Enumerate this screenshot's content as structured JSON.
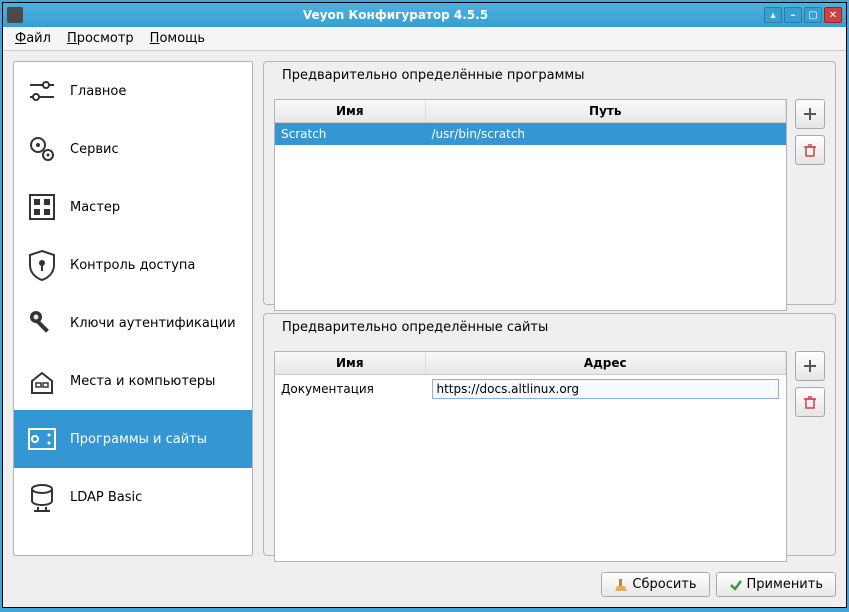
{
  "window": {
    "title": "Veyon Конфигуратор 4.5.5"
  },
  "menu": {
    "file": "Файл",
    "view": "Просмотр",
    "help": "Помощь"
  },
  "nav": {
    "main": "Главное",
    "service": "Сервис",
    "master": "Мастер",
    "access": "Контроль доступа",
    "keys": "Ключи аутентификации",
    "places": "Места и компьютеры",
    "programs": "Программы и сайты",
    "ldap": "LDAP Basic"
  },
  "groups": {
    "programs": {
      "title": "Предварительно определённые программы",
      "col_name": "Имя",
      "col_path": "Путь",
      "rows": [
        {
          "name": "Scratch",
          "path": "/usr/bin/scratch"
        }
      ]
    },
    "sites": {
      "title": "Предварительно определённые сайты",
      "col_name": "Имя",
      "col_addr": "Адрес",
      "rows": [
        {
          "name": "Документация",
          "addr": "https://docs.altlinux.org"
        }
      ]
    }
  },
  "buttons": {
    "reset": "Сбросить",
    "apply": "Применить"
  }
}
